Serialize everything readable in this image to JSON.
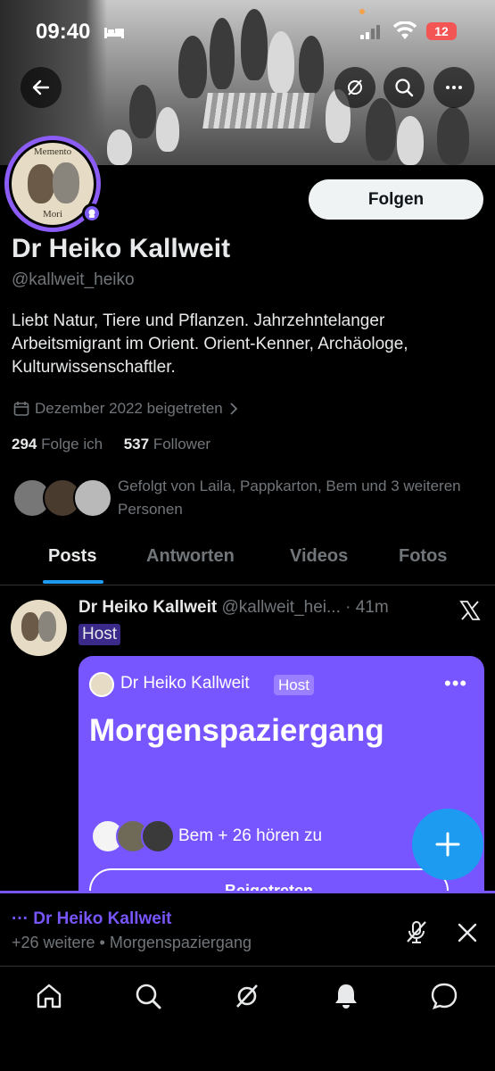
{
  "status_bar": {
    "time": "09:40",
    "battery": "12"
  },
  "profile": {
    "name": "Dr Heiko Kallweit",
    "handle": "@kallweit_heiko",
    "avatar_top_text": "Memento",
    "avatar_bottom_text": "Mori",
    "bio": "Liebt Natur, Tiere und Pflanzen. Jahrzehntelanger Arbeitsmigrant im Orient. Orient-Kenner, Archäologe, Kulturwissenschaftler.",
    "joined": "Dezember 2022 beigetreten",
    "following_count": "294",
    "following_label": "Folge ich",
    "followers_count": "537",
    "followers_label": "Follower",
    "followed_by": "Gefolgt von Laila, Pappkarton, Bem und 3 weiteren Personen",
    "follow_button": "Folgen"
  },
  "tabs": [
    {
      "label": "Posts",
      "active": true
    },
    {
      "label": "Antworten"
    },
    {
      "label": "Videos"
    },
    {
      "label": "Fotos"
    }
  ],
  "post": {
    "author": "Dr Heiko Kallweit",
    "handle": "@kallweit_hei...",
    "time": "· 41m",
    "badge": "Host",
    "space": {
      "host": "Dr Heiko Kallweit",
      "host_badge": "Host",
      "more": "•••",
      "title": "Morgenspaziergang",
      "listening": "Bem + 26 hören zu",
      "joined_button": "Beigetreten"
    }
  },
  "dock": {
    "title": "··· Dr Heiko Kallweit",
    "subtitle": "+26 weitere • Morgenspaziergang"
  },
  "colors": {
    "accent": "#1d9bf0",
    "spaces": "#7856ff",
    "avatar_ring": "#8b5cf6"
  },
  "icons": {
    "header": [
      "back-arrow-icon",
      "spaces-mute-icon",
      "search-icon",
      "more-icon"
    ],
    "nav": [
      "home-icon",
      "search-icon",
      "spaces-icon",
      "notifications-icon",
      "messages-icon"
    ]
  }
}
